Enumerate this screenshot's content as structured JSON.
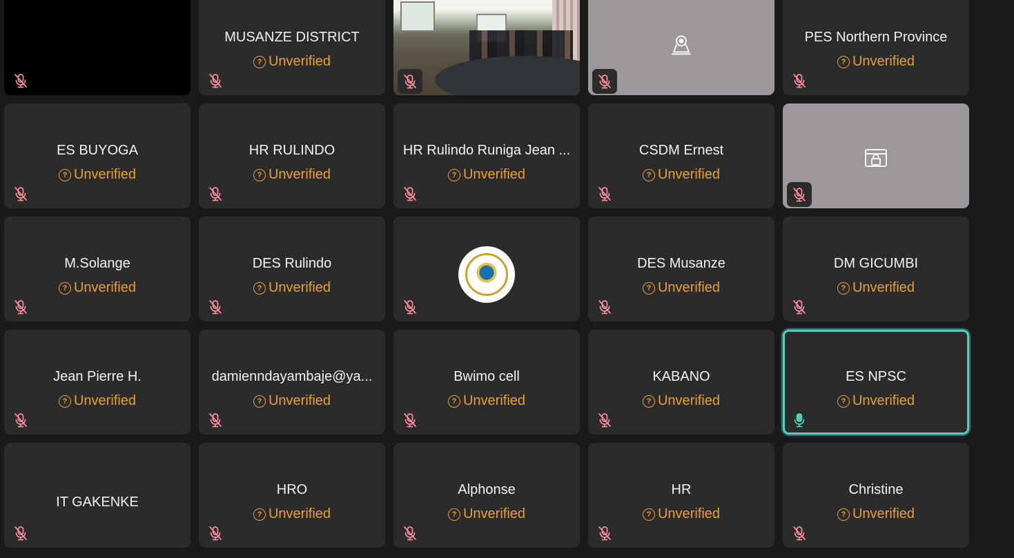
{
  "status_label": "Unverified",
  "accent_colors": {
    "unverified": "#e8a13a",
    "muted_mic": "#ff8ea0",
    "active_speaker": "#4fd1b2"
  },
  "tiles": [
    {
      "name": "",
      "kind": "black-video",
      "mic": "muted"
    },
    {
      "name": "MUSANZE DISTRICT",
      "status": "Unverified",
      "mic": "muted"
    },
    {
      "name": "",
      "kind": "camera-video",
      "mic": "muted"
    },
    {
      "name": "",
      "kind": "grey-placeholder",
      "icon": "webcam-icon",
      "mic": "muted"
    },
    {
      "name": "PES Northern Province",
      "status": "Unverified",
      "mic": "muted"
    },
    {
      "name": "ES BUYOGA",
      "status": "Unverified",
      "mic": "muted"
    },
    {
      "name": "HR RULINDO",
      "status": "Unverified",
      "mic": "muted"
    },
    {
      "name": "HR Rulindo Runiga Jean ...",
      "status": "Unverified",
      "mic": "muted"
    },
    {
      "name": "CSDM Ernest",
      "status": "Unverified",
      "mic": "muted"
    },
    {
      "name": "",
      "kind": "grey-placeholder",
      "icon": "locked-screen-icon",
      "mic": "muted"
    },
    {
      "name": "M.Solange",
      "status": "Unverified",
      "mic": "muted"
    },
    {
      "name": "DES Rulindo",
      "status": "Unverified",
      "mic": "muted"
    },
    {
      "name": "",
      "kind": "logo-avatar",
      "icon": "republic-of-rwanda-seal",
      "mic": "muted"
    },
    {
      "name": "DES Musanze",
      "status": "Unverified",
      "mic": "muted"
    },
    {
      "name": "DM GICUMBI",
      "status": "Unverified",
      "mic": "muted"
    },
    {
      "name": "Jean Pierre H.",
      "status": "Unverified",
      "mic": "muted"
    },
    {
      "name": "damienndayambaje@ya...",
      "status": "Unverified",
      "mic": "muted"
    },
    {
      "name": "Bwimo cell",
      "status": "Unverified",
      "mic": "muted"
    },
    {
      "name": "KABANO",
      "status": "Unverified",
      "mic": "muted"
    },
    {
      "name": "ES NPSC",
      "status": "Unverified",
      "mic": "active",
      "speaking": true
    },
    {
      "name": "IT GAKENKE",
      "mic": "muted"
    },
    {
      "name": "HRO",
      "status": "Unverified",
      "mic": "muted"
    },
    {
      "name": "Alphonse",
      "status": "Unverified",
      "mic": "muted"
    },
    {
      "name": "HR",
      "status": "Unverified",
      "mic": "muted"
    },
    {
      "name": "Christine",
      "status": "Unverified",
      "mic": "muted"
    }
  ]
}
